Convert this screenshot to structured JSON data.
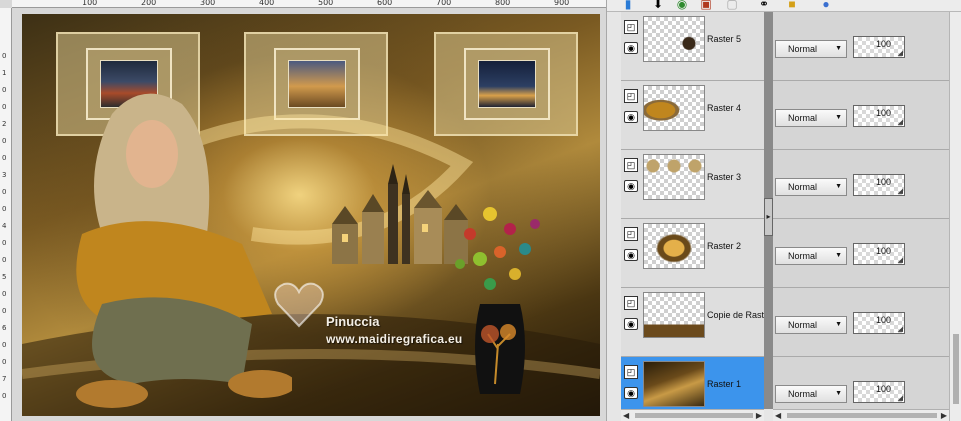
{
  "canvas": {
    "ruler_h_labels": [
      "100",
      "200",
      "300",
      "400",
      "500",
      "600",
      "700",
      "800",
      "900"
    ],
    "ruler_v_digits": [
      "0",
      "1",
      "0",
      "0",
      "2",
      "0",
      "0",
      "3",
      "0",
      "0",
      "4",
      "0",
      "0",
      "5",
      "0",
      "0",
      "6",
      "0",
      "0",
      "7",
      "0"
    ],
    "watermark": {
      "name": "Pinuccia",
      "site": "www.maidiregrafica.eu"
    }
  },
  "palette": {
    "toolbar_icons": [
      "new-layer-icon",
      "merge-down-icon",
      "visibility-icon",
      "delete-layer-icon",
      "mask-icon",
      "link-icon",
      "lock-icon",
      "globe-icon"
    ],
    "layers": [
      {
        "name": "Raster 5",
        "blend": "Normal",
        "opacity": "100",
        "selected": false,
        "thumb": "vase-small"
      },
      {
        "name": "Raster 4",
        "blend": "Normal",
        "opacity": "100",
        "selected": false,
        "thumb": "woman"
      },
      {
        "name": "Raster 3",
        "blend": "Normal",
        "opacity": "100",
        "selected": false,
        "thumb": "frames"
      },
      {
        "name": "Raster 2",
        "blend": "Normal",
        "opacity": "100",
        "selected": false,
        "thumb": "glow"
      },
      {
        "name": "Copie de Raste",
        "blend": "Normal",
        "opacity": "100",
        "selected": false,
        "thumb": "band"
      },
      {
        "name": "Raster 1",
        "blend": "Normal",
        "opacity": "100",
        "selected": true,
        "thumb": "background"
      }
    ]
  },
  "colors": {
    "selected_layer": "#3c94ec",
    "divider": "#8a8a8a"
  }
}
